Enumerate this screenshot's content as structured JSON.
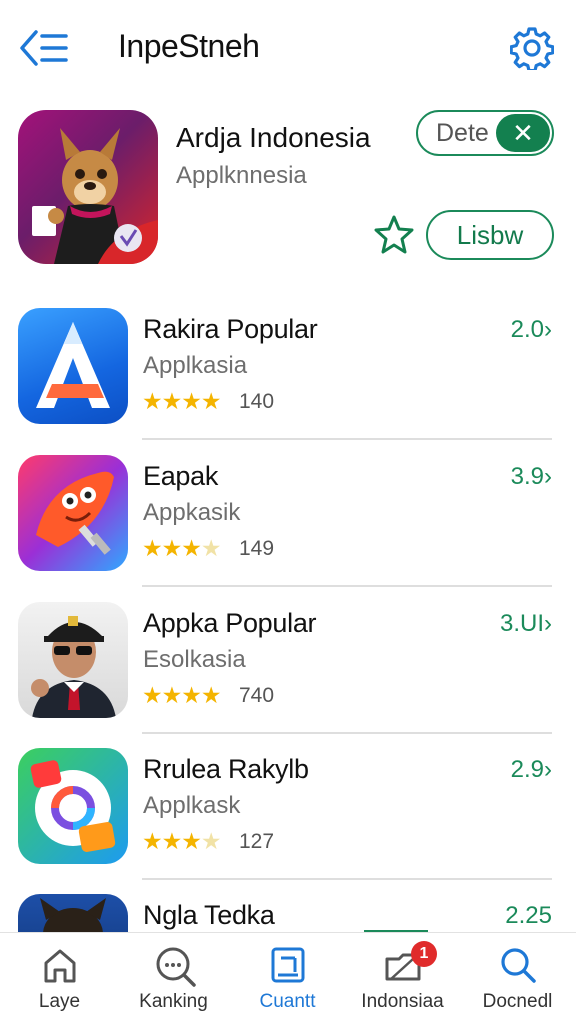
{
  "header": {
    "title": "InpeStneh",
    "back_icon": "back-menu-icon",
    "settings_icon": "gear-icon",
    "accent_color": "#1e78d6"
  },
  "featured": {
    "title": "Ardja Indonesia",
    "subtitle": "Applknnesia",
    "toggle_label": "Dete",
    "toggle_symbol": "✕",
    "list_button": "Lisbw",
    "favorite_icon": "star-outline-icon",
    "accent_color": "#13804f"
  },
  "apps": [
    {
      "name": "Rakira Popular",
      "subtitle": "Applkasia",
      "stars": "★★★★",
      "dim": "",
      "count": "140",
      "score": "2.0›"
    },
    {
      "name": "Eapak",
      "subtitle": "Appkasik",
      "stars": "★★★",
      "dim": "★",
      "count": "149",
      "score": "3.9›"
    },
    {
      "name": "Appka Popular",
      "subtitle": "Esolkasia",
      "stars": "★★★★",
      "dim": "",
      "count": "740",
      "score": "3.UI›"
    },
    {
      "name": "Rrulea Rakylb",
      "subtitle": "Applkask",
      "stars": "★★★",
      "dim": "★",
      "count": "127",
      "score": "2.9›"
    },
    {
      "name": "Ngla Tedka",
      "score": "2.25"
    }
  ],
  "bottom_nav": [
    {
      "label": "Laye",
      "icon": "home-icon"
    },
    {
      "label": "Kanking",
      "icon": "search-chat-icon"
    },
    {
      "label": "Cuantt",
      "icon": "tablet-icon"
    },
    {
      "label": "Indonsiaa",
      "icon": "folder-icon",
      "badge": "1"
    },
    {
      "label": "Docnedl",
      "icon": "search-icon"
    }
  ]
}
